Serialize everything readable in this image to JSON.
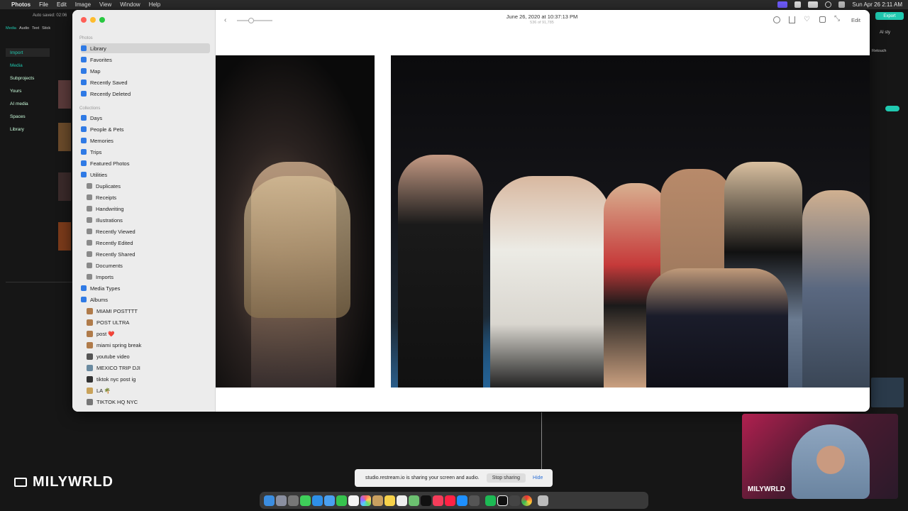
{
  "menubar": {
    "apple": "",
    "app_name": "Photos",
    "items": [
      "File",
      "Edit",
      "Image",
      "View",
      "Window",
      "Help"
    ],
    "datetime": "Sun Apr 26  2:11 AM"
  },
  "capcut": {
    "autosave": "Auto saved: 02:06",
    "tabs": [
      "Media",
      "Audio",
      "Text",
      "Stick"
    ],
    "side": [
      "Import",
      "Media",
      "Subprojects",
      "Yours",
      "AI media",
      "Spaces",
      "Library"
    ],
    "export": "Export",
    "ai_style": "AI sty",
    "retouch": "Retouch"
  },
  "photos": {
    "header_date": "June 26, 2020 at 10:37:13 PM",
    "header_count": "536 of 91,785",
    "edit_label": "Edit",
    "sections": {
      "photos": "Photos",
      "collections": "Collections"
    },
    "photos_items": [
      {
        "label": "Library"
      },
      {
        "label": "Favorites"
      },
      {
        "label": "Map"
      },
      {
        "label": "Recently Saved"
      },
      {
        "label": "Recently Deleted"
      }
    ],
    "collection_items": [
      {
        "label": "Days"
      },
      {
        "label": "People & Pets"
      },
      {
        "label": "Memories"
      },
      {
        "label": "Trips"
      },
      {
        "label": "Featured Photos"
      },
      {
        "label": "Utilities"
      }
    ],
    "utilities": [
      {
        "label": "Duplicates"
      },
      {
        "label": "Receipts"
      },
      {
        "label": "Handwriting"
      },
      {
        "label": "Illustrations"
      },
      {
        "label": "Recently Viewed"
      },
      {
        "label": "Recently Edited"
      },
      {
        "label": "Recently Shared"
      },
      {
        "label": "Documents"
      },
      {
        "label": "Imports"
      }
    ],
    "media_types": "Media Types",
    "albums_label": "Albums",
    "albums": [
      {
        "label": "MIAMI POSTTTT"
      },
      {
        "label": "POST ULTRA"
      },
      {
        "label": "post ❤️"
      },
      {
        "label": "miami spring break"
      },
      {
        "label": "youtube video"
      },
      {
        "label": "MEXICO TRIP DJI"
      },
      {
        "label": "tiktok nyc post ig"
      },
      {
        "label": "LA 🌴"
      },
      {
        "label": "TIKTOK HQ NYC"
      }
    ]
  },
  "share_bar": {
    "message": "studio.restream.io is sharing your screen and audio.",
    "stop": "Stop sharing",
    "hide": "Hide"
  },
  "watermark": "MILYWRLD",
  "cam_label": "MILYWRLD",
  "colors": {
    "accent": "#2f7ae5",
    "capcut_teal": "#20c9b0",
    "close": "#ff5f57",
    "minimize": "#febc2e",
    "zoom": "#28c840"
  }
}
